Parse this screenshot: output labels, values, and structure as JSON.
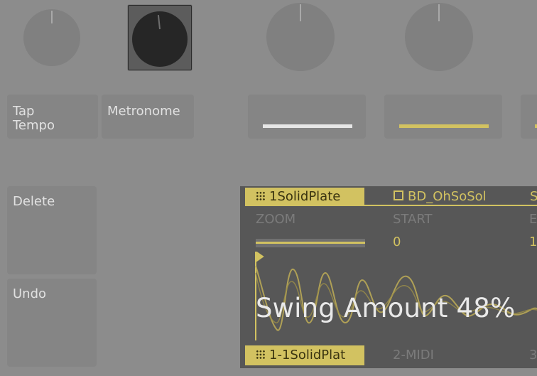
{
  "pads": {
    "tap_tempo": "Tap\nTempo",
    "metronome": "Metronome",
    "delete": "Delete",
    "undo": "Undo"
  },
  "display": {
    "tracks": [
      {
        "name": "1SolidPlate",
        "selected": true
      },
      {
        "name": "BD_OhSoSol"
      },
      {
        "name": "S"
      }
    ],
    "params": [
      {
        "label": "ZOOM",
        "value": ""
      },
      {
        "label": "START",
        "value": "0"
      },
      {
        "label": "E",
        "value": "1"
      }
    ],
    "swing_message": "Swing Amount 48%",
    "bottom_tabs": [
      {
        "name": "1-1SolidPlat"
      },
      {
        "name": "2-MIDI"
      },
      {
        "name": "3"
      }
    ]
  },
  "colors": {
    "background": "#8c8c8c",
    "accent": "#d2c261",
    "display_bg": "#575757"
  }
}
